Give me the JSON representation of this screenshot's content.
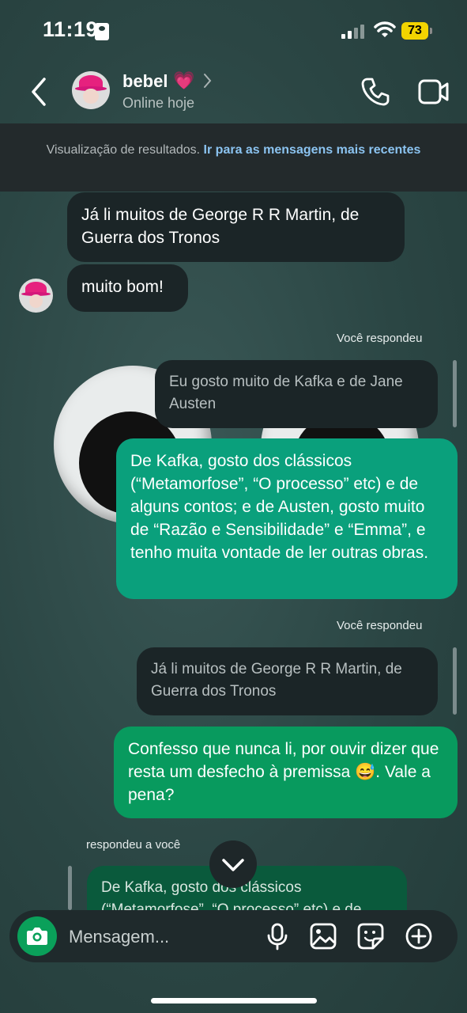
{
  "status_bar": {
    "time": "11:19",
    "battery": "73"
  },
  "header": {
    "name": "bebel",
    "heart": "💗",
    "status": "Online hoje"
  },
  "banner": {
    "text": "Visualização de resultados. ",
    "link": "Ir para as mensagens mais recentes"
  },
  "messages": {
    "m1": "Já li muitos de George R R Martin, de Guerra dos Tronos",
    "m2": "muito bom!",
    "reply_label_1": "Você respondeu",
    "quote_1": "Eu gosto muito de Kafka e de Jane Austen",
    "m3": "De Kafka, gosto dos clássicos (“Metamorfose”, “O processo” etc) e de alguns contos; e de Austen, gosto muito de “Razão e Sensibilidade” e “Emma”, e tenho muita vontade de ler outras obras.",
    "reply_label_2": "Você respondeu",
    "quote_2": "Já li muitos de George R R Martin, de Guerra dos Tronos",
    "m4_emoji": "😅",
    "m4_pre": "Confesso que nunca li, por ouvir dizer que resta um desfecho à premissa ",
    "m4_post": ". Vale a pena?",
    "reply_label_3": "respondeu a você",
    "quote_3": "De Kafka, gosto dos clássicos (“Metamorfose”, “O processo” etc) e de"
  },
  "composer": {
    "placeholder": "Mensagem..."
  },
  "icons": [
    "back-icon",
    "chevron-right-icon",
    "phone-icon",
    "video-icon",
    "chevron-down-icon",
    "camera-icon",
    "microphone-icon",
    "image-icon",
    "sticker-icon",
    "plus-icon"
  ],
  "colors": {
    "incoming": "#1b2527",
    "outgoing": "#0aa07c",
    "banner_link": "#8bc3f0",
    "accent_green": "#0aa05a"
  }
}
